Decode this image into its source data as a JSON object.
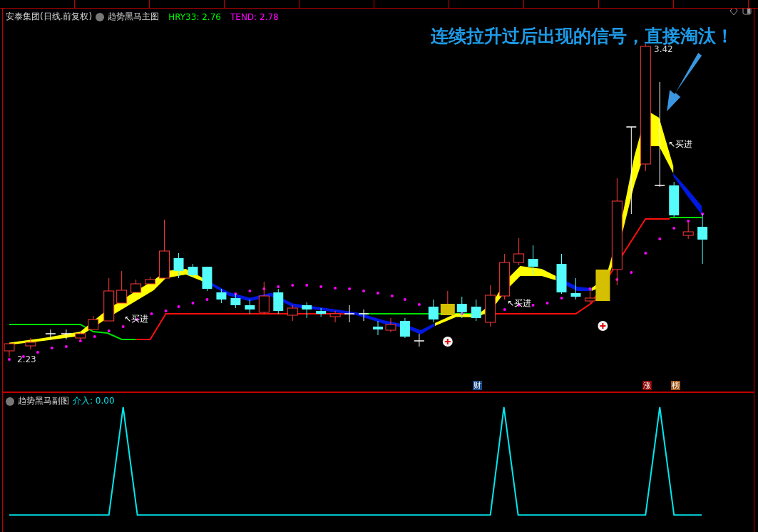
{
  "title": {
    "stock": "安泰集团(日线.前复权)",
    "indicator": "趋势黑马主图",
    "values": [
      {
        "text": "HRY33: 2.76",
        "color": "#00ff00"
      },
      {
        "text": "TEND: 2.78",
        "color": "#ff00ff"
      }
    ]
  },
  "headline": "连续拉升过后出现的信号，直接淘汰！",
  "price_labels": {
    "high": "3.42",
    "low": "2.23"
  },
  "signals": [
    "↖买进",
    "↖买进",
    "↖买进"
  ],
  "event_badges": [
    {
      "text": "财",
      "color": "#1c4a8a"
    },
    {
      "text": "涨",
      "color": "#8b0000"
    },
    {
      "text": "榜",
      "color": "#a0581a"
    }
  ],
  "sub_panel": {
    "title": "趋势黑马副图",
    "value": "介入: 0.00"
  }
}
